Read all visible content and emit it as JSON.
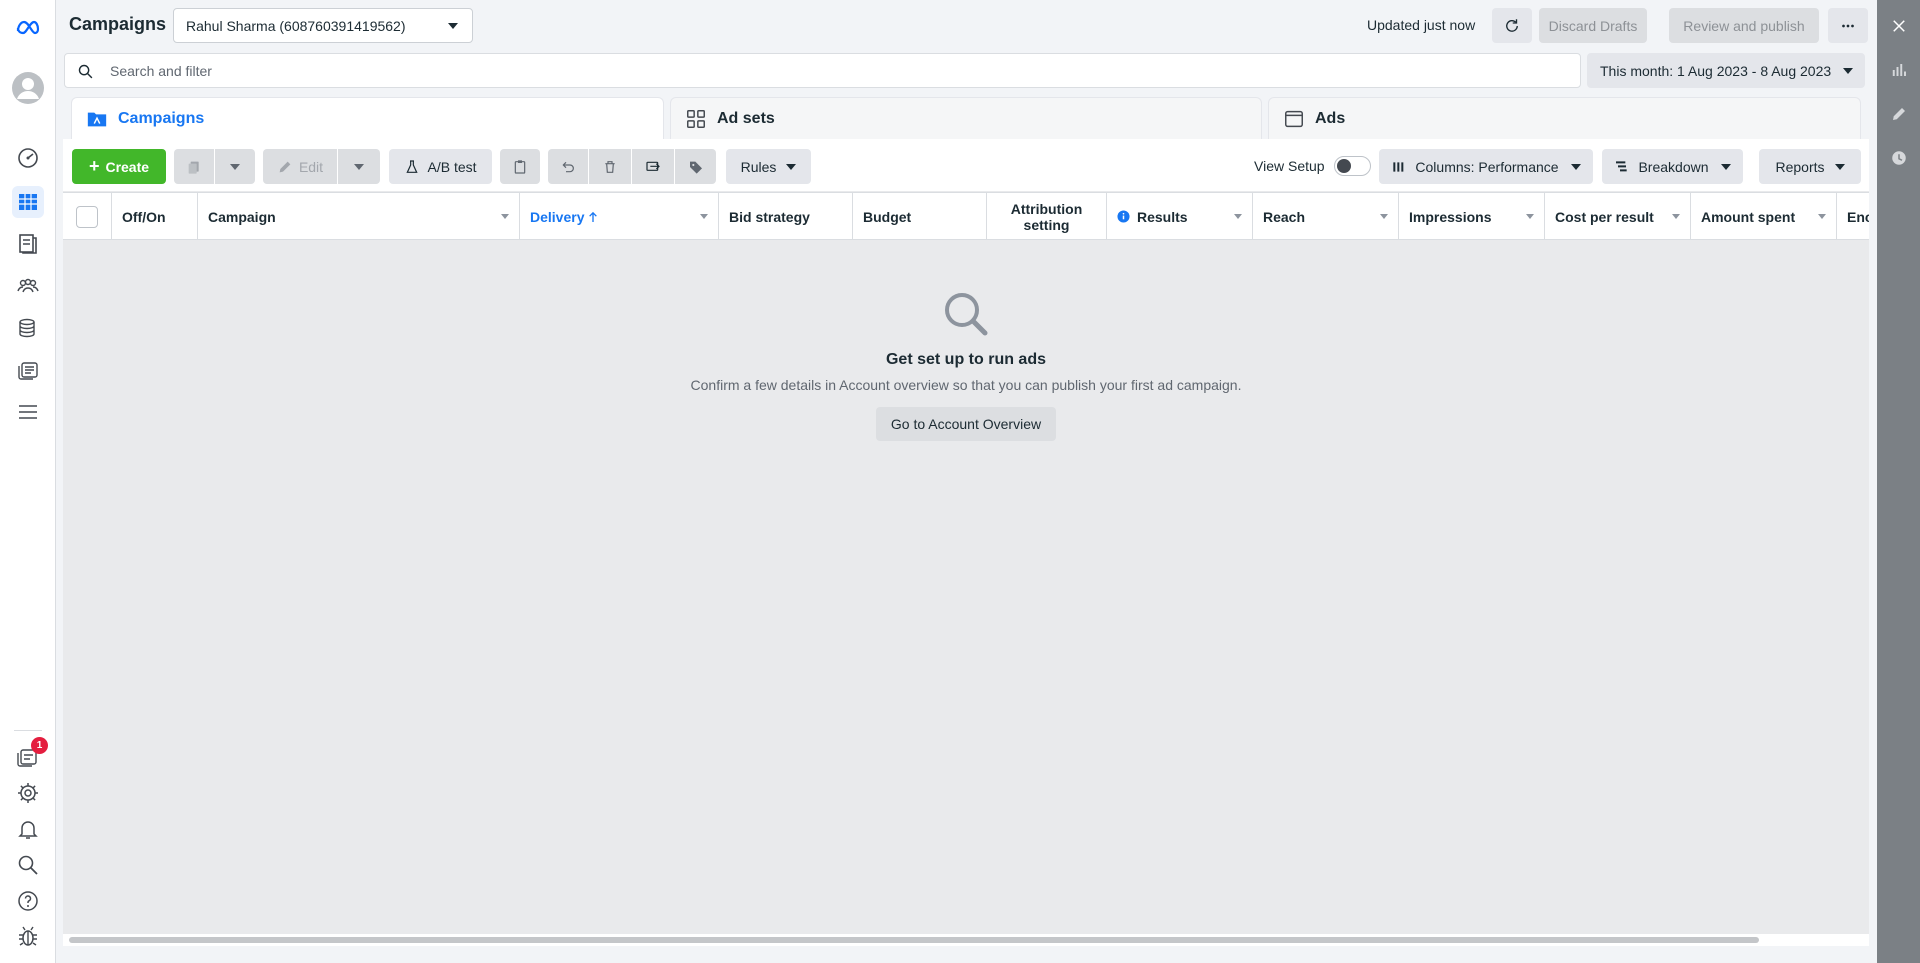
{
  "header": {
    "title": "Campaigns",
    "account": "Rahul Sharma (608760391419562)",
    "updated": "Updated just now",
    "discard_label": "Discard Drafts",
    "publish_label": "Review and publish"
  },
  "search": {
    "placeholder": "Search and filter",
    "date_range": "This month: 1 Aug 2023 - 8 Aug 2023"
  },
  "tabs": [
    {
      "label": "Campaigns"
    },
    {
      "label": "Ad sets"
    },
    {
      "label": "Ads"
    }
  ],
  "toolbar": {
    "create_label": "Create",
    "edit_label": "Edit",
    "ab_test_label": "A/B test",
    "rules_label": "Rules",
    "view_setup_label": "View Setup",
    "columns_label": "Columns: Performance",
    "breakdown_label": "Breakdown",
    "reports_label": "Reports"
  },
  "table": {
    "columns": [
      "Off/On",
      "Campaign",
      "Delivery",
      "Bid strategy",
      "Budget",
      "Attribution setting",
      "Results",
      "Reach",
      "Impressions",
      "Cost per result",
      "Amount spent",
      "Enc"
    ]
  },
  "empty_state": {
    "title": "Get set up to run ads",
    "description": "Confirm a few details in Account overview so that you can publish your first ad campaign.",
    "button_label": "Go to Account Overview"
  },
  "nav": {
    "notification_count": "1"
  },
  "colors": {
    "accent": "#1877f2",
    "create": "#42b72a",
    "badge": "#e41e3f"
  }
}
